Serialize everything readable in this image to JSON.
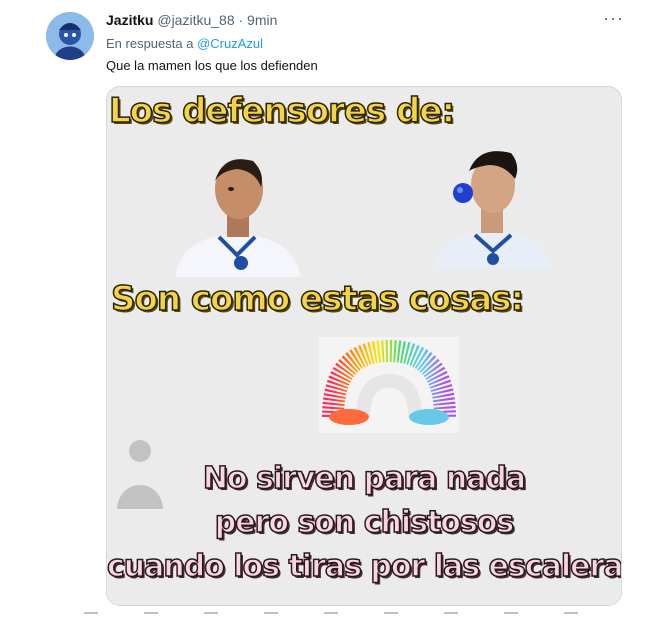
{
  "tweet": {
    "display_name": "Jazitku",
    "handle_time": "@jazitku_88 · 9min",
    "reply_prefix": "En respuesta a",
    "reply_to": "@CruzAzul",
    "text": "Que la mamen los que los defienden",
    "more_icon": "more-horizontal-icon"
  },
  "meme": {
    "line1": "Los defensores de:",
    "line2": "Son como estas cosas:",
    "line3a": "No sirven para nada",
    "line3b": "pero son chistosos",
    "line3c": "cuando los tiras por las escaleras"
  },
  "colors": {
    "link": "#1d9bf0",
    "meme_yellow": "#f3d34a",
    "meme_pink": "#f8d7e3",
    "jersey_blue": "#1f4fa3"
  }
}
